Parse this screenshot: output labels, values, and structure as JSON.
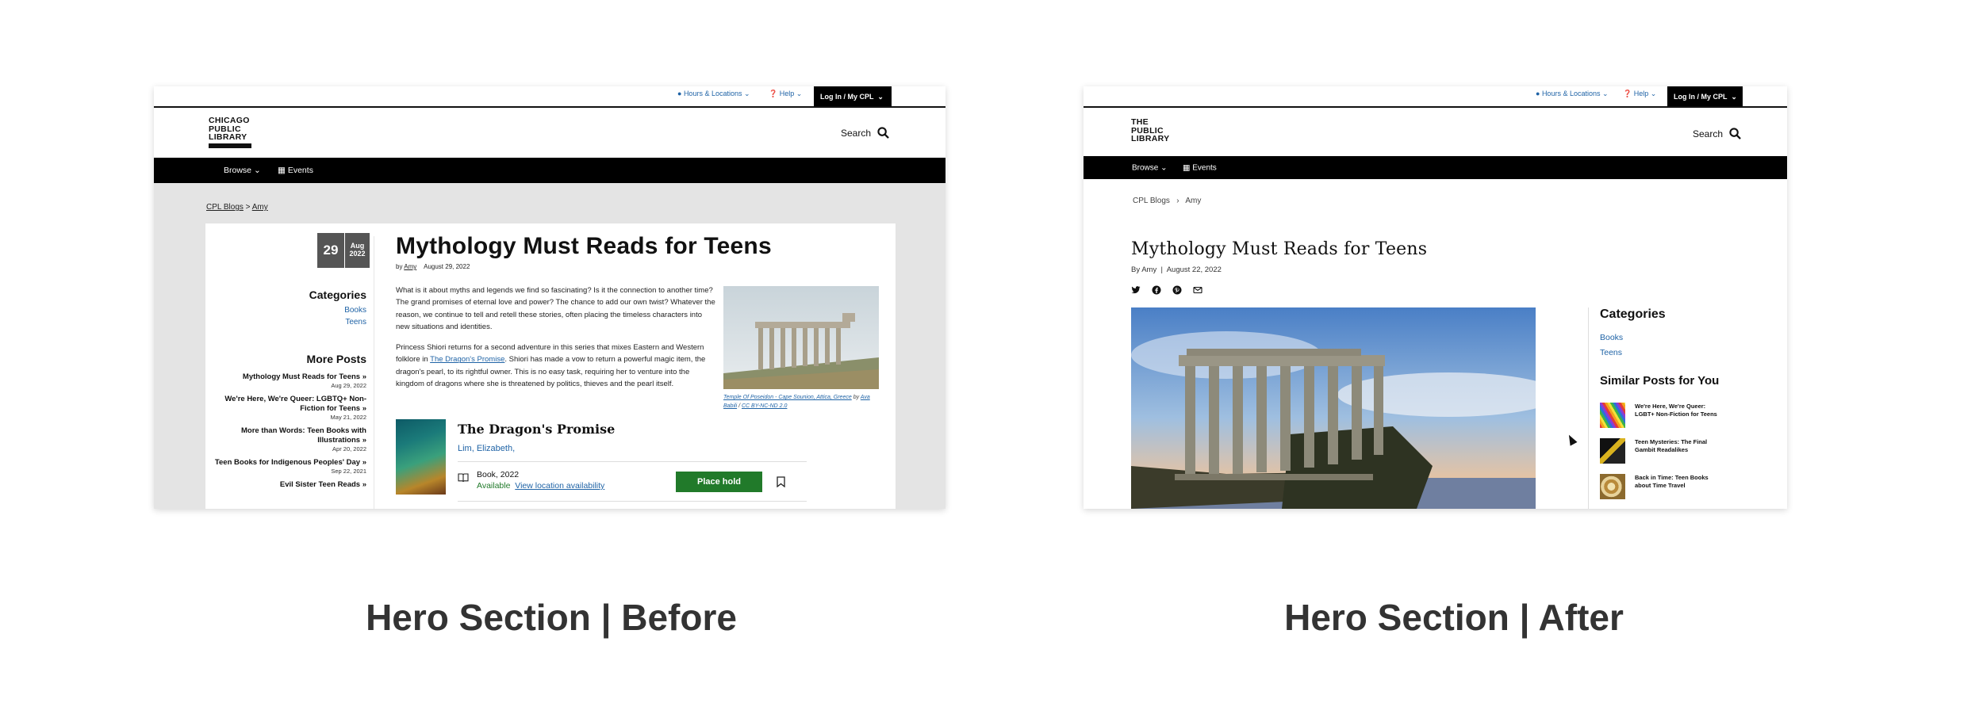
{
  "before": {
    "utility": {
      "hours": "Hours & Locations",
      "help": "Help",
      "login": "Log In / My CPL"
    },
    "logo": [
      "CHICAGO",
      "PUBLIC",
      "LIBRARY"
    ],
    "search_label": "Search",
    "nav": {
      "browse": "Browse",
      "events": "Events"
    },
    "breadcrumb": {
      "root": "CPL Blogs",
      "sep": ">",
      "leaf": "Amy"
    },
    "date": {
      "day": "29",
      "month": "Aug",
      "year": "2022"
    },
    "post": {
      "title": "Mythology Must Reads for Teens",
      "by": "by",
      "author": "Amy",
      "date": "August 29, 2022",
      "para1": "What is it about myths and legends we find so fascinating? Is it the connection to another time? The grand promises of eternal love and power? The chance to add our own twist? Whatever the reason, we continue to tell and retell these stories, often placing the timeless characters into new situations and identities.",
      "para2_before": "Princess Shiori returns for a second adventure in this series that mixes Eastern and Western folklore in ",
      "para2_link": "The Dragon's Promise",
      "para2_after": ". Shiori has made a vow to return a powerful magic item, the dragon's pearl, to its rightful owner. This is no easy task, requiring her to venture into the kingdom of dragons where she is threatened by politics, thieves and the pearl itself.",
      "photo_caption_text": "Temple Of Poseidon - Cape Sounion, Attica, Greece",
      "photo_caption_by": "by",
      "photo_caption_author": "Ava Babili",
      "photo_caption_sep": "/",
      "photo_caption_license": "CC BY-NC-ND 2.0"
    },
    "categories": {
      "heading": "Categories",
      "items": [
        "Books",
        "Teens"
      ]
    },
    "more_posts": {
      "heading": "More Posts",
      "items": [
        {
          "title": "Mythology Must Reads for Teens »",
          "date": "Aug 29, 2022"
        },
        {
          "title": "We're Here, We're Queer: LGBTQ+ Non-Fiction for Teens »",
          "date": "May 21, 2022"
        },
        {
          "title": "More than Words: Teen Books with Illustrations »",
          "date": "Apr 20, 2022"
        },
        {
          "title": "Teen Books for Indigenous Peoples' Day »",
          "date": "Sep 22, 2021"
        },
        {
          "title": "Evil Sister Teen Reads »",
          "date": ""
        }
      ]
    },
    "book": {
      "title": "The Dragon's Promise",
      "author": "Lim, Elizabeth,",
      "format": "Book, 2022",
      "status": "Available",
      "location_link": "View location availability",
      "hold_label": "Place hold"
    }
  },
  "after": {
    "utility": {
      "hours": "Hours & Locations",
      "help": "Help",
      "login": "Log In / My CPL"
    },
    "logo": [
      "THE",
      "PUBLIC",
      "LIBRARY"
    ],
    "search_label": "Search",
    "nav": {
      "browse": "Browse",
      "events": "Events"
    },
    "breadcrumb": {
      "root": "CPL Blogs",
      "leaf": "Amy"
    },
    "post": {
      "title": "Mythology Must Reads for Teens",
      "byline": "By Amy  |  August 22, 2022"
    },
    "categories": {
      "heading": "Categories",
      "items": [
        "Books",
        "Teens"
      ]
    },
    "similar": {
      "heading": "Similar Posts for You",
      "items": [
        "We're Here, We're Queer: LGBT+ Non-Fiction for Teens",
        "Teen Mysteries: The Final Gambit Readalikes",
        "Back in Time: Teen Books about Time Travel"
      ]
    }
  },
  "captions": {
    "before": "Hero Section | Before",
    "after": "Hero Section | After"
  },
  "colors": {
    "link": "#1f63a6",
    "hold_button": "#217a2a",
    "nav": "#000000",
    "date_box": "#555555",
    "before_bg": "#e4e4e4"
  },
  "icons": [
    "map-pin-icon",
    "help-circle-icon",
    "chevron-down-icon",
    "search-icon",
    "calendar-icon",
    "twitter-icon",
    "facebook-icon",
    "pinterest-icon",
    "email-icon",
    "book-icon",
    "bookmark-icon",
    "mouse-cursor-icon"
  ]
}
